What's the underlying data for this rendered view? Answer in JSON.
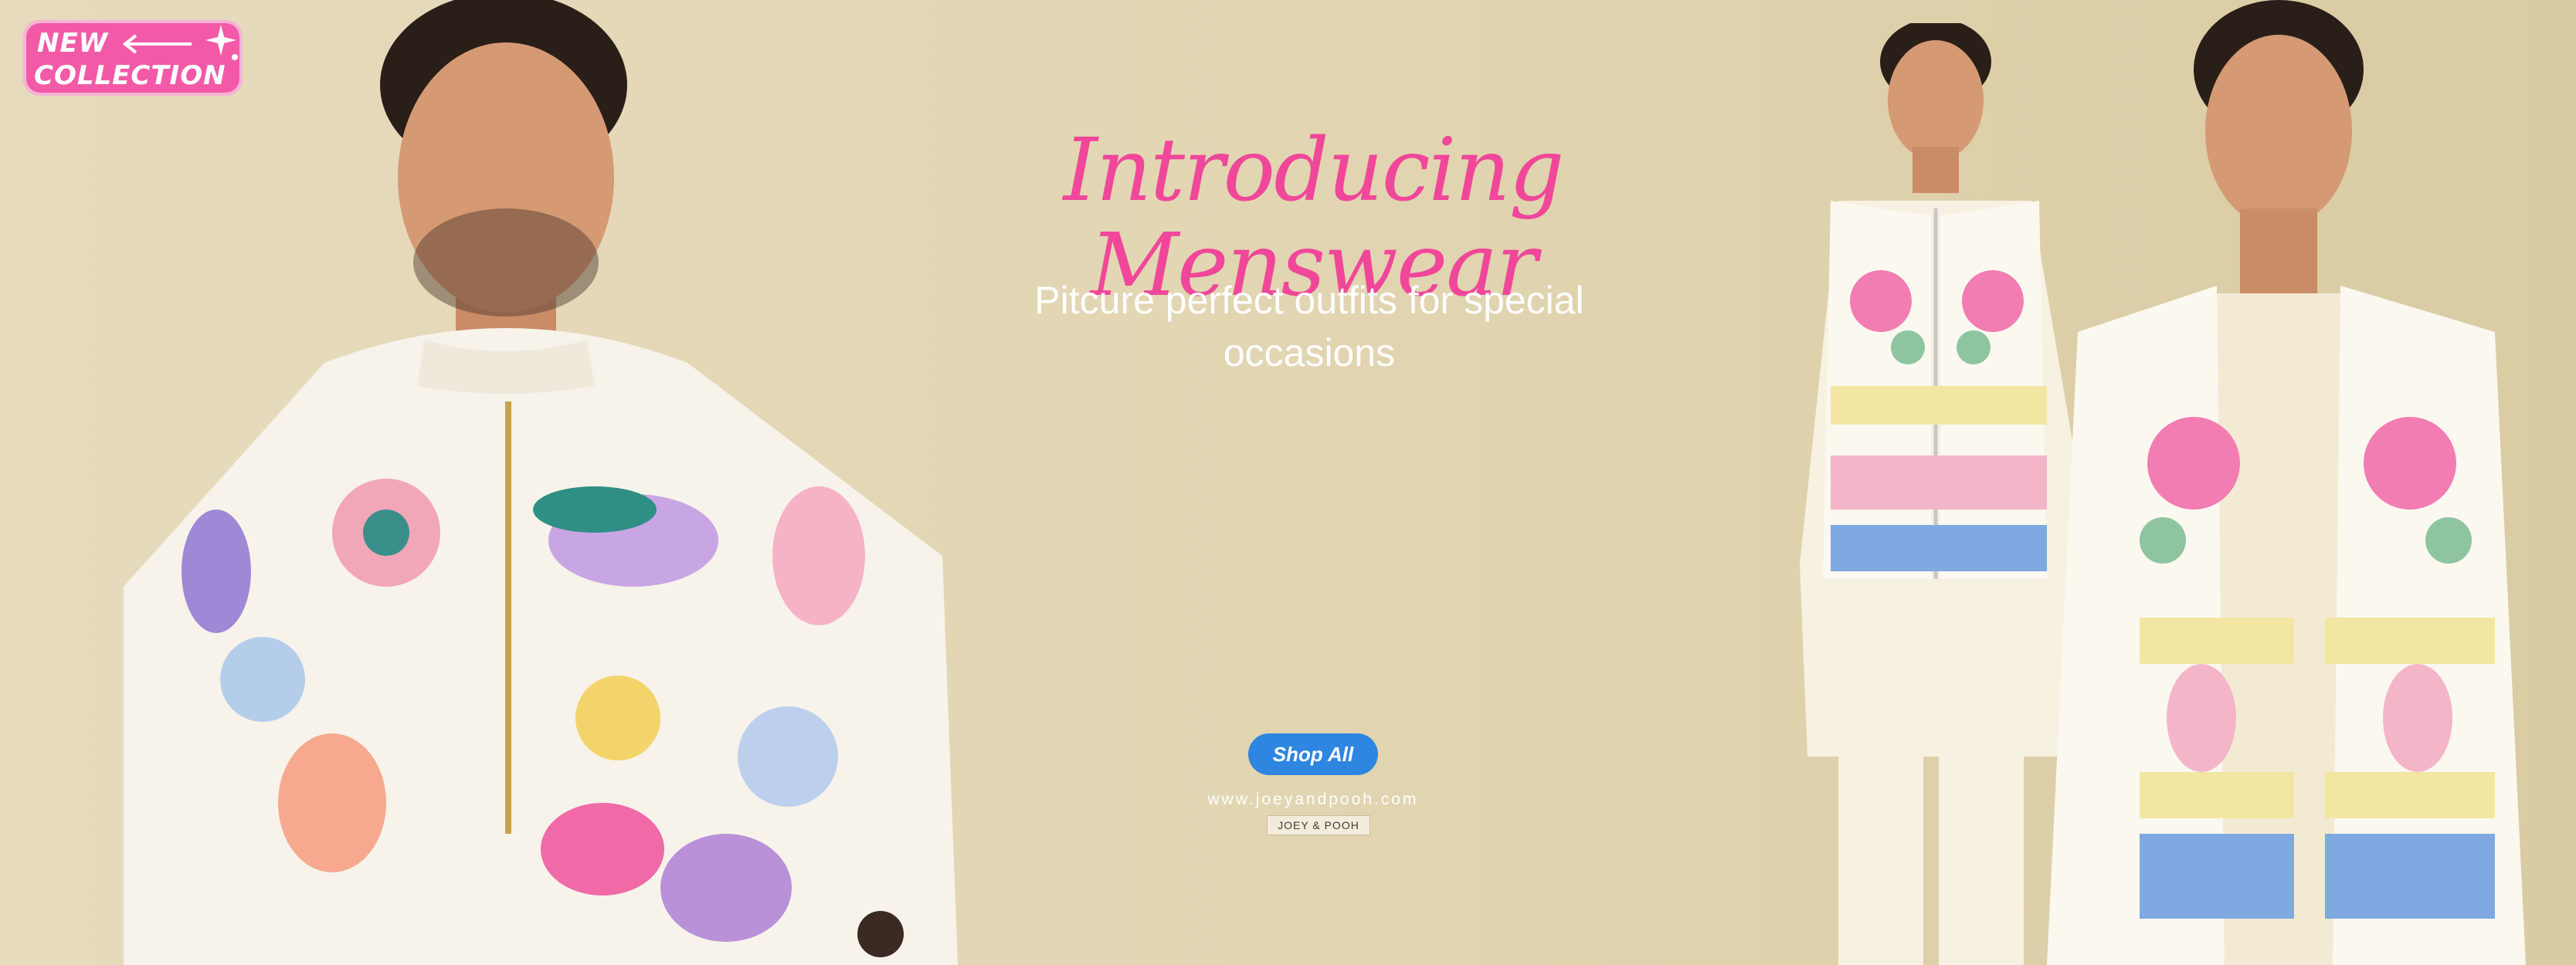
{
  "badge": {
    "line1": "NEW",
    "line2": "COLLECTION",
    "icon": "sparkle-arrow-icon"
  },
  "hero": {
    "headline": "Introducing Menswear",
    "subheadline": "Pitcure perfect outfits for special occasions",
    "cta_label": "Shop All",
    "site_url": "www.joeyandpooh.com",
    "brand_tag": "JOEY & POOH"
  },
  "colors": {
    "background": "#e4d7b6",
    "headline": "#f0479a",
    "badge": "#f25aa7",
    "button": "#2e86e0",
    "kurta_white": "#f7f3ea"
  }
}
